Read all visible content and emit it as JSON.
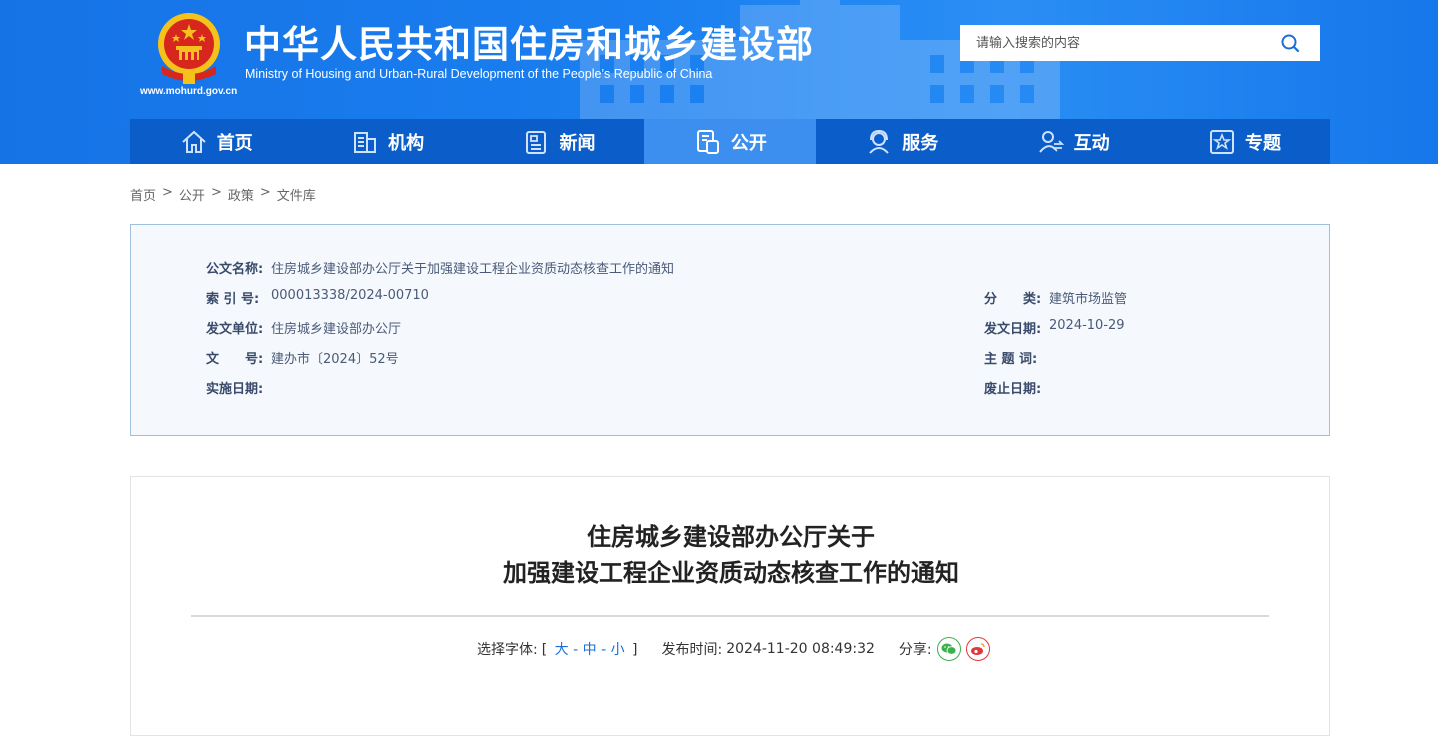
{
  "header": {
    "title": "中华人民共和国住房和城乡建设部",
    "subtitle": "Ministry of Housing and Urban-Rural Development of the People’s Republic of China",
    "domain": "www.mohurd.gov.cn",
    "search_placeholder": "请输入搜索的内容"
  },
  "nav": {
    "items": [
      {
        "label": "首页",
        "icon": "home-icon"
      },
      {
        "label": "机构",
        "icon": "building-icon"
      },
      {
        "label": "新闻",
        "icon": "news-icon"
      },
      {
        "label": "公开",
        "icon": "document-icon",
        "active": true
      },
      {
        "label": "服务",
        "icon": "service-icon"
      },
      {
        "label": "互动",
        "icon": "interact-icon"
      },
      {
        "label": "专题",
        "icon": "star-icon"
      }
    ]
  },
  "breadcrumb": [
    "首页",
    "公开",
    "政策",
    "文件库"
  ],
  "info": {
    "name_label": "公文名称:",
    "name_value": "住房城乡建设部办公厅关于加强建设工程企业资质动态核查工作的通知",
    "index_label": "索 引 号:",
    "index_value": "000013338/2024-00710",
    "category_label": "分　　类:",
    "category_value": "建筑市场监管",
    "issuer_label": "发文单位:",
    "issuer_value": "住房城乡建设部办公厅",
    "issue_date_label": "发文日期:",
    "issue_date_value": "2024-10-29",
    "doc_no_label": "文　　号:",
    "doc_no_value": "建办市〔2024〕52号",
    "subject_label": "主 题 词:",
    "subject_value": "",
    "effective_label": "实施日期:",
    "effective_value": "",
    "expire_label": "废止日期:",
    "expire_value": ""
  },
  "article": {
    "title_line1": "住房城乡建设部办公厅关于",
    "title_line2": "加强建设工程企业资质动态核查工作的通知",
    "font_label": "选择字体:",
    "font_open": "[",
    "font_large": "大",
    "font_medium": "中",
    "font_small": "小",
    "font_close": "]",
    "dash": "-",
    "publish_label": "发布时间:",
    "publish_time": "2024-11-20 08:49:32",
    "share_label": "分享:"
  },
  "colors": {
    "header_blue": "#1a7ff0",
    "nav_blue": "#0b5ec9",
    "nav_active": "#3d8fef",
    "wechat_green": "#3bb14a",
    "weibo_red": "#e0383a"
  }
}
